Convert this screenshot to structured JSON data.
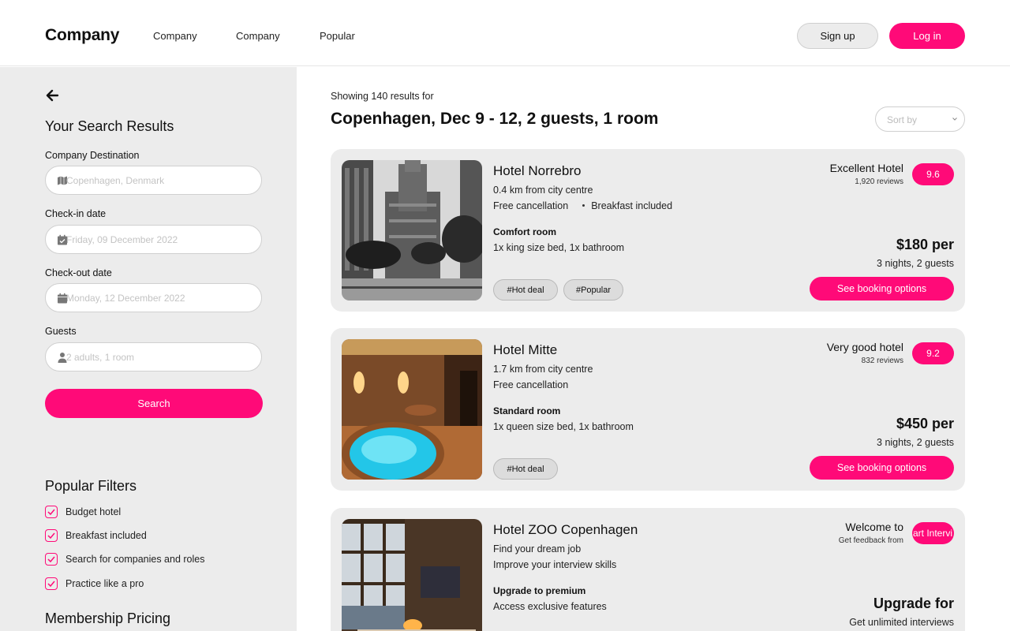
{
  "header": {
    "logo": "Company",
    "nav": [
      "Company",
      "Company",
      "Popular"
    ],
    "signup_label": "Sign up",
    "login_label": "Log in"
  },
  "sidebar": {
    "title": "Your Search Results",
    "fields": [
      {
        "label": "Company Destination",
        "placeholder": "Copenhagen, Denmark",
        "icon": "map-icon"
      },
      {
        "label": "Check-in date",
        "placeholder": "Friday, 09 December 2022",
        "icon": "calendar-check-icon"
      },
      {
        "label": "Check-out date",
        "placeholder": "Monday, 12 December 2022",
        "icon": "calendar-icon"
      },
      {
        "label": "Guests",
        "placeholder": "2 adults, 1 room",
        "icon": "person-icon"
      }
    ],
    "search_label": "Search",
    "filters_title": "Popular Filters",
    "filters": [
      "Budget hotel",
      "Breakfast included",
      "Search for companies and roles",
      "Practice like a pro"
    ],
    "pricing_title": "Membership Pricing"
  },
  "main": {
    "showing": "Showing 140 results for",
    "query": "Copenhagen, Dec 9 - 12, 2 guests, 1 room",
    "sort_label": "Sort by",
    "results": [
      {
        "name": "Hotel Norrebro",
        "distance": "0.4 km from city centre",
        "perk1": "Free cancellation",
        "perk2": "Breakfast included",
        "room": "Comfort room",
        "beds": "1x king size bed, 1x bathroom",
        "tags": [
          "#Hot deal",
          "#Popular"
        ],
        "rating_label": "Excellent Hotel",
        "reviews": "1,920 reviews",
        "score": "9.6",
        "price": "$180 per",
        "nights": "3 nights, 2 guests",
        "cta": "See booking options"
      },
      {
        "name": "Hotel Mitte",
        "distance": "1.7 km from city centre",
        "perk1": "Free cancellation",
        "room": "Standard room",
        "beds": "1x queen size bed, 1x bathroom",
        "tags": [
          "#Hot deal"
        ],
        "rating_label": "Very good hotel",
        "reviews": "832 reviews",
        "score": "9.2",
        "price": "$450 per",
        "nights": "3 nights, 2 guests",
        "cta": "See booking options"
      },
      {
        "name": "Hotel ZOO Copenhagen",
        "distance": "Find your dream job",
        "perk1": "Improve your interview skills",
        "room": "Upgrade to premium",
        "beds": "Access exclusive features",
        "rating_label": "Welcome to",
        "reviews": "Get feedback from",
        "score": "art Intervi",
        "price": "Upgrade for",
        "nights": "Get unlimited interviews"
      }
    ]
  },
  "colors": {
    "accent": "#ff0a78",
    "panel": "#ececec"
  }
}
